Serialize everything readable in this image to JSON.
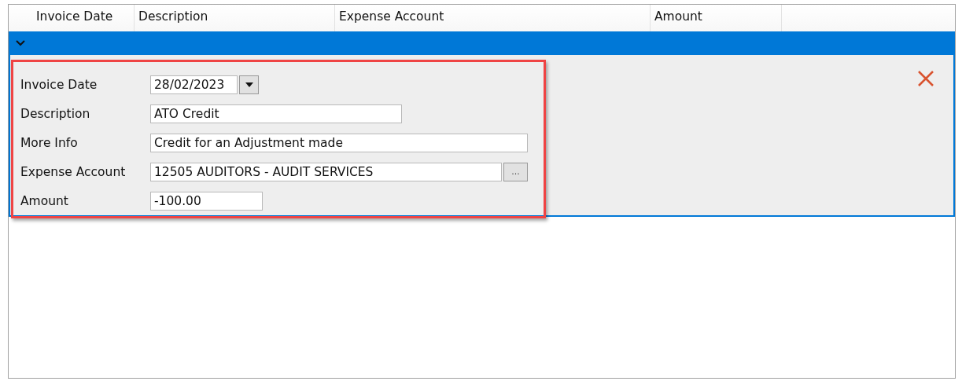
{
  "table": {
    "columns": [
      "Invoice Date",
      "Description",
      "Expense Account",
      "Amount"
    ],
    "rows": [
      {
        "expanded": true,
        "selected": true,
        "fields": [
          {
            "kind": "date",
            "label": "Invoice Date",
            "value": "28/02/2023"
          },
          {
            "kind": "text",
            "label": "Description",
            "value": "ATO Credit"
          },
          {
            "kind": "text",
            "label": "More Info",
            "value": "Credit for an Adjustment made"
          },
          {
            "kind": "lookup",
            "label": "Expense Account",
            "value": "12505 AUDITORS - AUDIT SERVICES",
            "button": "..."
          },
          {
            "kind": "text",
            "label": "Amount",
            "value": "-100.00"
          }
        ]
      }
    ]
  }
}
